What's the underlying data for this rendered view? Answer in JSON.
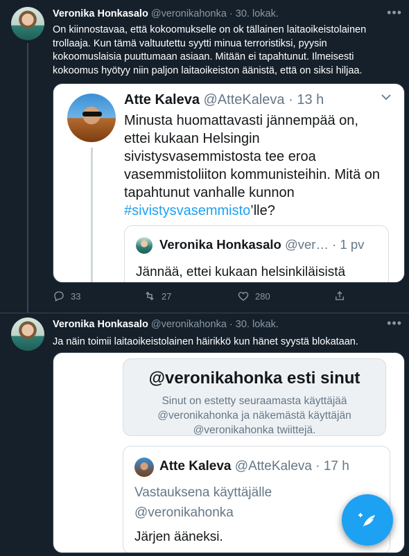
{
  "tweet1": {
    "author_name": "Veronika Honkasalo",
    "author_handle": "@veronikahonka",
    "separator": "·",
    "date": "30. lokak.",
    "more": "•••",
    "text": "On kiinnostavaa, että kokoomukselle on ok tällainen laitaoikeistolainen trollaaja. Kun tämä valtuutettu syytti minua terroristiksi, pyysin kokoomuslaisia puuttumaan asiaan. Mitään ei tapahtunut. Ilmeisesti kokoomus hyötyy niin paljon laitaoikeiston äänistä, että on siksi hiljaa.",
    "quote": {
      "author_name": "Atte Kaleva",
      "author_handle": "@AtteKaleva",
      "separator": "·",
      "time": "13 h",
      "text_before": "Minusta huomattavasti jännempää on, ettei kukaan Helsingin sivistysvasemmistosta tee eroa vasemmistoliiton kommunisteihin. Mitä on tapahtunut vanhalle kunnon ",
      "hashtag": "#sivistysvasemmisto",
      "text_after": "’lle?",
      "inner": {
        "author_name": "Veronika Honkasalo",
        "author_handle": "@ver…",
        "separator": "·",
        "time": "1 pv",
        "text": "Jännää, ettei kukaan helsinkiläisistä"
      }
    },
    "actions": {
      "replies": "33",
      "retweets": "27",
      "likes": "280"
    }
  },
  "tweet2": {
    "author_name": "Veronika Honkasalo",
    "author_handle": "@veronikahonka",
    "separator": "·",
    "date": "30. lokak.",
    "more": "•••",
    "text": "Ja näin toimii laitaoikeistolainen häirikkö kun hänet syystä blokataan.",
    "image": {
      "blocked_title": "@veronikahonka esti sinut",
      "blocked_text": "Sinut on estetty seuraamasta käyttäjää @veronikahonka ja näkemästä käyttäjän @veronikahonka twiittejä.",
      "reply_author_name": "Atte Kaleva",
      "reply_author_handle": "@AtteKaleva",
      "reply_separator": "·",
      "reply_time": "17 h",
      "reply_context": "Vastauksena käyttäjälle @veronikahonka",
      "reply_text": "Järjen ääneksi."
    }
  },
  "colors": {
    "background": "#15202b",
    "accent": "#1da1f2",
    "muted": "#8899a6",
    "border": "#38444d"
  },
  "fab": {
    "icon": "compose-tweet-icon"
  }
}
